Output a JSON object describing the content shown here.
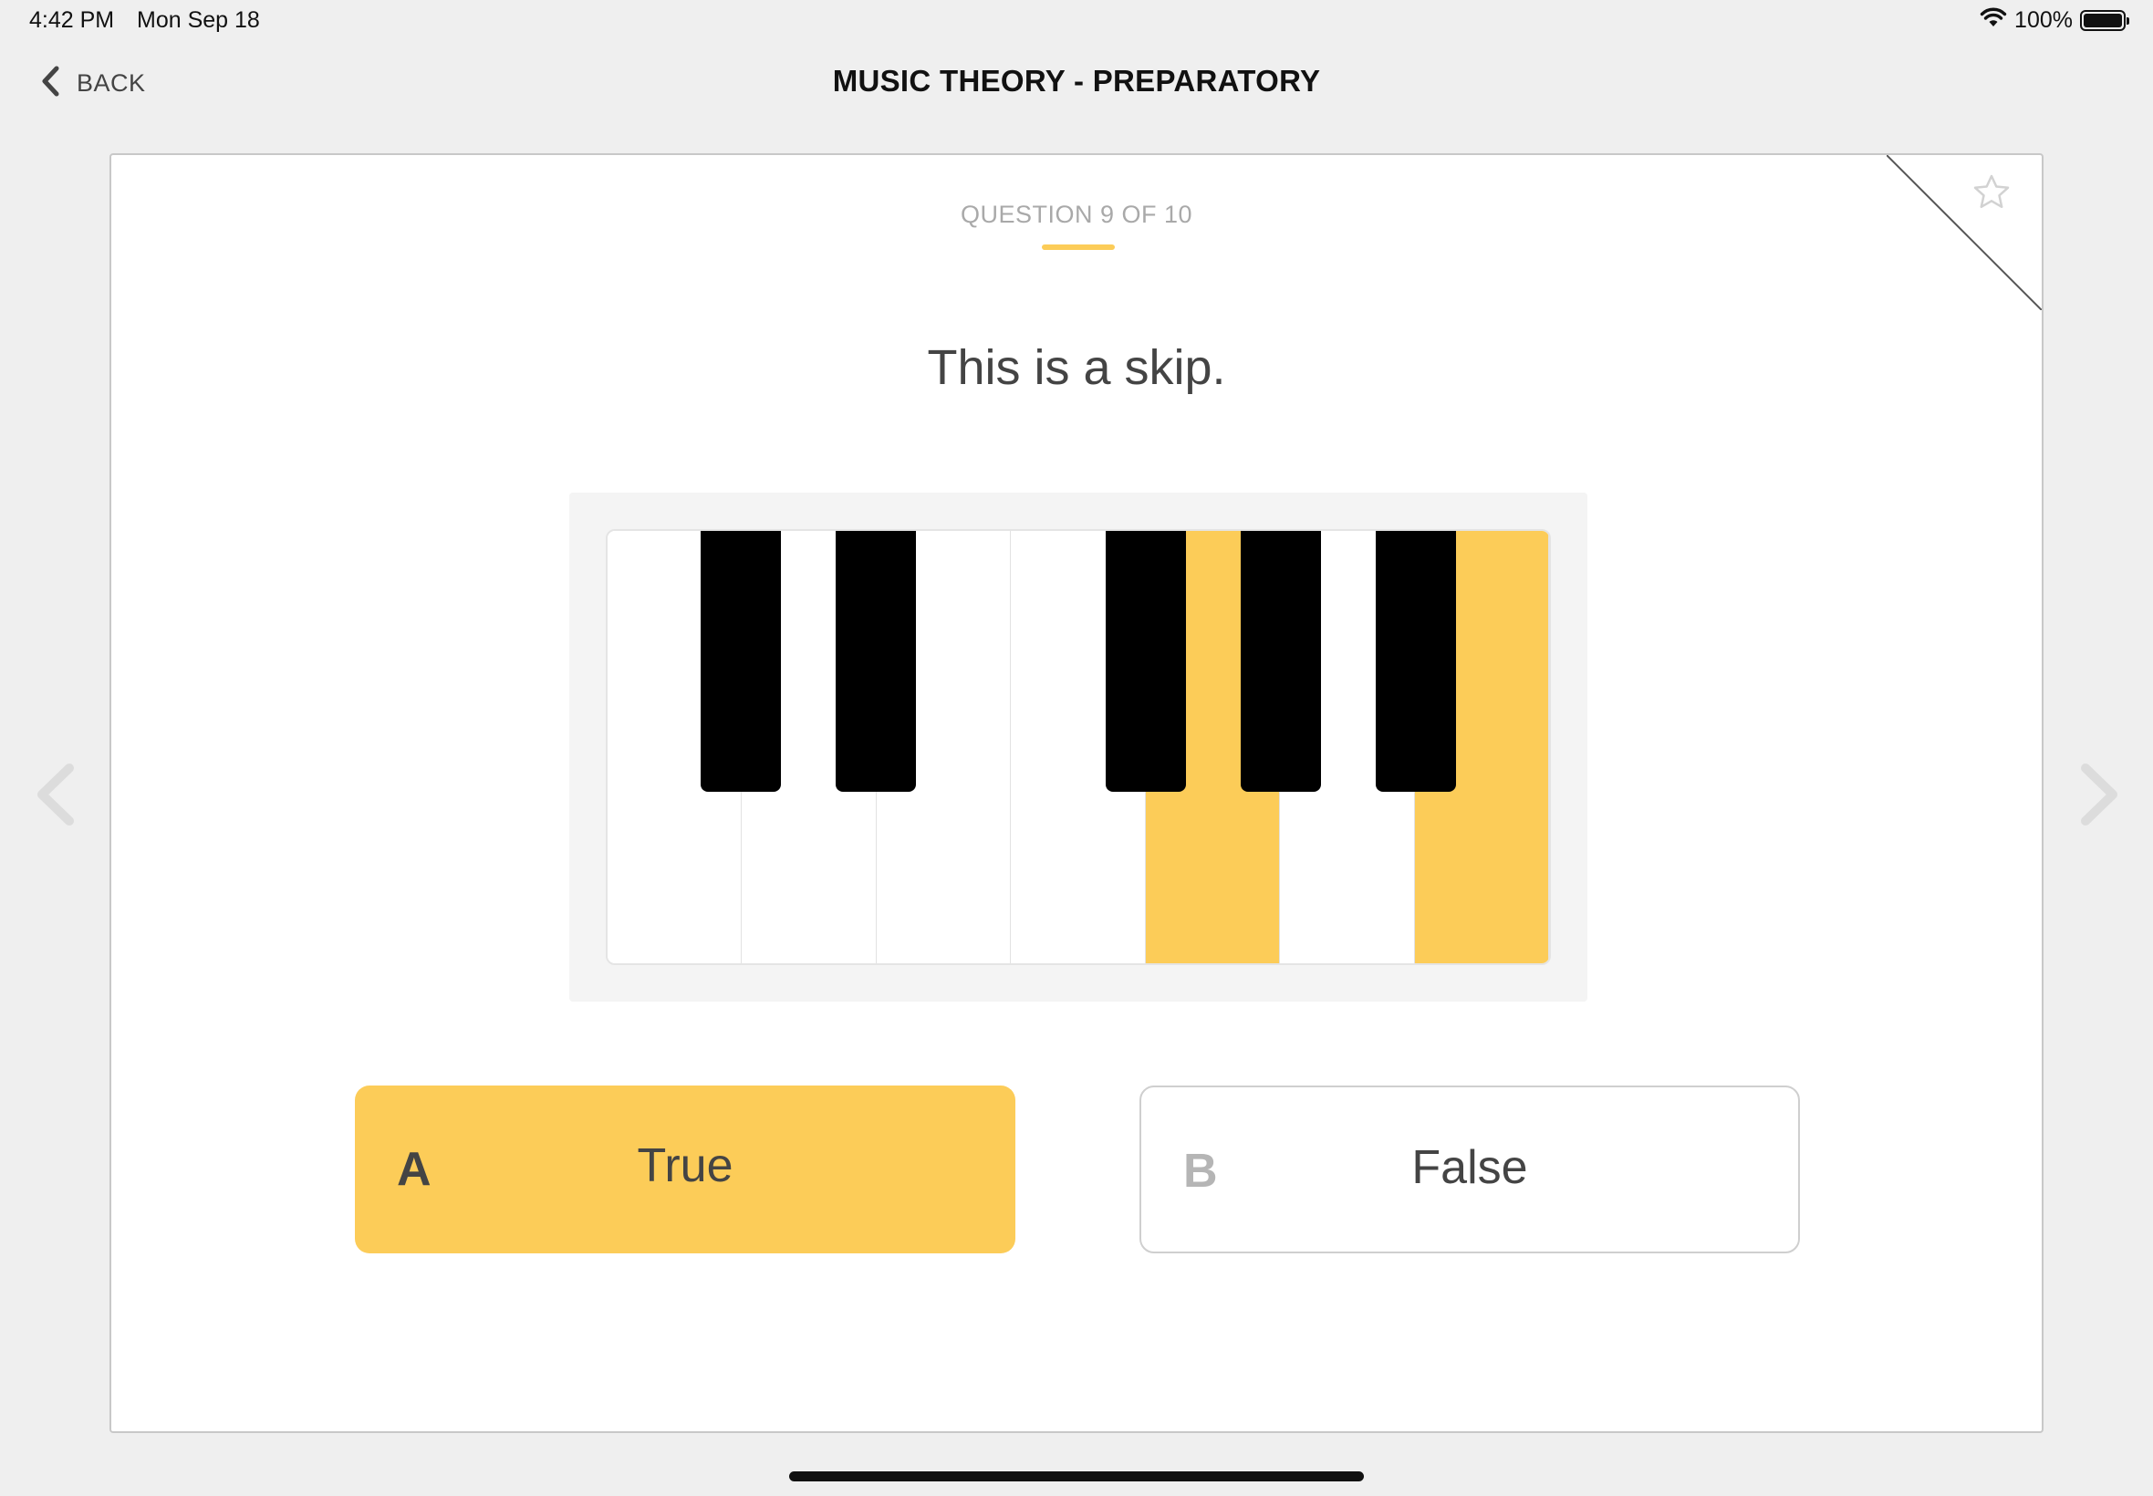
{
  "status_bar": {
    "time": "4:42 PM",
    "date": "Mon Sep 18",
    "battery": "100%"
  },
  "nav": {
    "back_label": "BACK",
    "title": "MUSIC THEORY - PREPARATORY"
  },
  "quiz": {
    "counter": "QUESTION 9 OF 10",
    "question": "This is a skip.",
    "highlighted_white_keys": [
      4,
      6
    ],
    "total_white_keys": 7,
    "answers": [
      {
        "letter": "A",
        "text": "True",
        "selected": true
      },
      {
        "letter": "B",
        "text": "False",
        "selected": false
      }
    ]
  },
  "colors": {
    "accent": "#fccc58",
    "background": "#efefef",
    "card": "#ffffff",
    "black_key": "#000000",
    "letter_selected": "#444444",
    "letter_unselected": "#b5b5b5",
    "arrow_disabled": "#dcdcdc"
  },
  "icons": {
    "back": "chevron-left-icon",
    "favorite": "star-outline-icon",
    "wifi": "wifi-icon",
    "battery": "battery-icon",
    "previous": "chevron-left-icon",
    "next": "chevron-right-icon"
  }
}
